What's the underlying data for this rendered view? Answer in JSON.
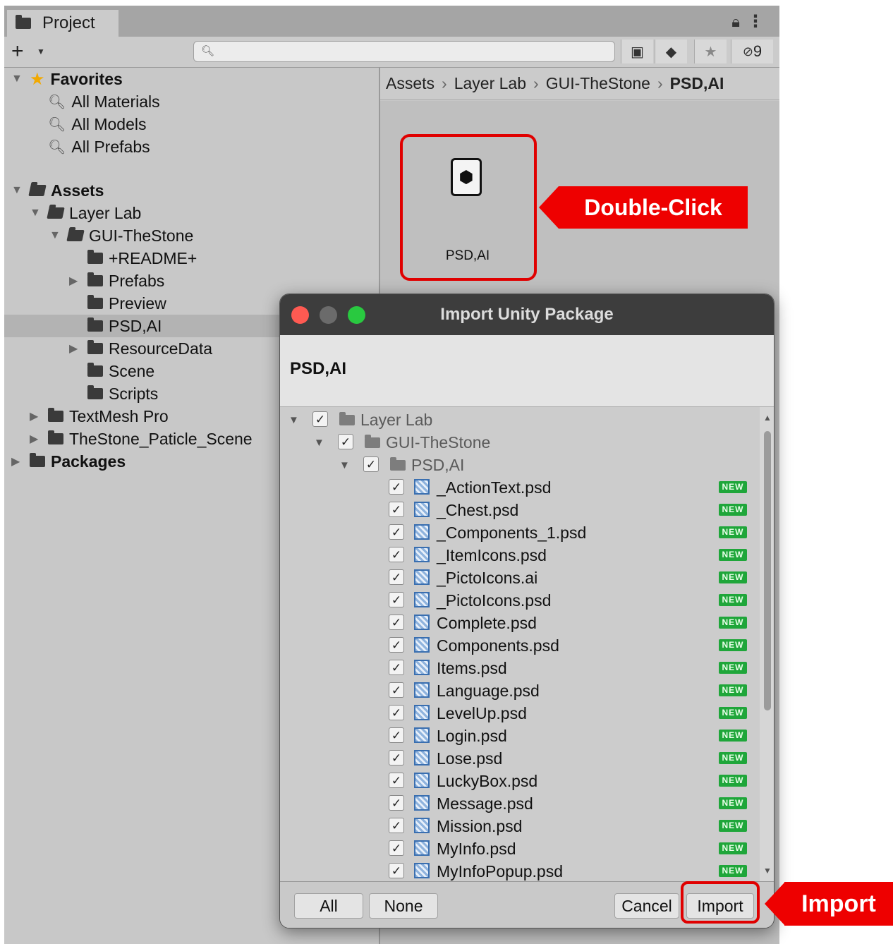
{
  "project": {
    "tab_label": "Project",
    "toolbar": {
      "plus_label": "+",
      "hidden_count": "9"
    },
    "favorites": {
      "label": "Favorites",
      "items": [
        "All Materials",
        "All Models",
        "All Prefabs"
      ]
    },
    "assets": {
      "label": "Assets",
      "layer_lab": "Layer Lab",
      "gui_thestone": "GUI-TheStone",
      "children": [
        "+README+",
        "Prefabs",
        "Preview",
        "PSD,AI",
        "ResourceData",
        "Scene",
        "Scripts"
      ],
      "textmesh": "TextMesh Pro",
      "particle": "TheStone_Paticle_Scene"
    },
    "packages": "Packages",
    "breadcrumb": [
      "Assets",
      "Layer Lab",
      "GUI-TheStone",
      "PSD,AI"
    ],
    "asset_item_label": "PSD,AI"
  },
  "callouts": {
    "double_click": "Double-Click",
    "import": "Import"
  },
  "dialog": {
    "title": "Import Unity Package",
    "package_name": "PSD,AI",
    "tree": {
      "root": "Layer Lab",
      "sub": "GUI-TheStone",
      "folder": "PSD,AI"
    },
    "badge": "NEW",
    "files": [
      "_ActionText.psd",
      "_Chest.psd",
      "_Components_1.psd",
      "_ItemIcons.psd",
      "_PictoIcons.ai",
      "_PictoIcons.psd",
      "Complete.psd",
      "Components.psd",
      "Items.psd",
      "Language.psd",
      "LevelUp.psd",
      "Login.psd",
      "Lose.psd",
      "LuckyBox.psd",
      "Message.psd",
      "Mission.psd",
      "MyInfo.psd",
      "MyInfoPopup.psd"
    ],
    "buttons": {
      "all": "All",
      "none": "None",
      "cancel": "Cancel",
      "import": "Import"
    }
  },
  "colors": {
    "callout": "#ee0000",
    "new_badge": "#1fa63a",
    "titlebar": "#3d3d3d"
  }
}
